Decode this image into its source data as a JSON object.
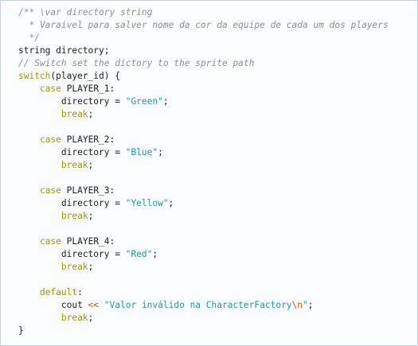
{
  "colors": {
    "background": "#fbfcfd",
    "border": "#c4cfe5",
    "comment": "#8f8f8f",
    "keyword": "#979a00",
    "string": "#1a9aa8",
    "escape": "#d14f00",
    "plain": "#202020"
  },
  "code_lines": [
    [
      {
        "type": "comment",
        "text": "/** \\var directory string"
      }
    ],
    [
      {
        "type": "comment",
        "text": "  * Varaivel para salver nome da cor da equipe de cada um dos players"
      }
    ],
    [
      {
        "type": "comment",
        "text": "  */"
      }
    ],
    [
      {
        "type": "plain",
        "text": "string directory;"
      }
    ],
    [
      {
        "type": "comment",
        "text": "// Switch set the dictory to the sprite path"
      }
    ],
    [
      {
        "type": "keyword",
        "text": "switch"
      },
      {
        "type": "plain",
        "text": "(player_id) {"
      }
    ],
    [
      {
        "type": "plain",
        "text": "    "
      },
      {
        "type": "keyword",
        "text": "case"
      },
      {
        "type": "plain",
        "text": " PLAYER_1:"
      }
    ],
    [
      {
        "type": "plain",
        "text": "        directory = "
      },
      {
        "type": "string",
        "text": "\"Green\""
      },
      {
        "type": "plain",
        "text": ";"
      }
    ],
    [
      {
        "type": "plain",
        "text": "        "
      },
      {
        "type": "keyword",
        "text": "break"
      },
      {
        "type": "plain",
        "text": ";"
      }
    ],
    [
      {
        "type": "plain",
        "text": ""
      }
    ],
    [
      {
        "type": "plain",
        "text": "    "
      },
      {
        "type": "keyword",
        "text": "case"
      },
      {
        "type": "plain",
        "text": " PLAYER_2:"
      }
    ],
    [
      {
        "type": "plain",
        "text": "        directory = "
      },
      {
        "type": "string",
        "text": "\"Blue\""
      },
      {
        "type": "plain",
        "text": ";"
      }
    ],
    [
      {
        "type": "plain",
        "text": "        "
      },
      {
        "type": "keyword",
        "text": "break"
      },
      {
        "type": "plain",
        "text": ";"
      }
    ],
    [
      {
        "type": "plain",
        "text": ""
      }
    ],
    [
      {
        "type": "plain",
        "text": "    "
      },
      {
        "type": "keyword",
        "text": "case"
      },
      {
        "type": "plain",
        "text": " PLAYER_3:"
      }
    ],
    [
      {
        "type": "plain",
        "text": "        directory = "
      },
      {
        "type": "string",
        "text": "\"Yellow\""
      },
      {
        "type": "plain",
        "text": ";"
      }
    ],
    [
      {
        "type": "plain",
        "text": "        "
      },
      {
        "type": "keyword",
        "text": "break"
      },
      {
        "type": "plain",
        "text": ";"
      }
    ],
    [
      {
        "type": "plain",
        "text": ""
      }
    ],
    [
      {
        "type": "plain",
        "text": "    "
      },
      {
        "type": "keyword",
        "text": "case"
      },
      {
        "type": "plain",
        "text": " PLAYER_4:"
      }
    ],
    [
      {
        "type": "plain",
        "text": "        directory = "
      },
      {
        "type": "string",
        "text": "\"Red\""
      },
      {
        "type": "plain",
        "text": ";"
      }
    ],
    [
      {
        "type": "plain",
        "text": "        "
      },
      {
        "type": "keyword",
        "text": "break"
      },
      {
        "type": "plain",
        "text": ";"
      }
    ],
    [
      {
        "type": "plain",
        "text": ""
      }
    ],
    [
      {
        "type": "plain",
        "text": "    "
      },
      {
        "type": "keyword",
        "text": "default"
      },
      {
        "type": "plain",
        "text": ":"
      }
    ],
    [
      {
        "type": "plain",
        "text": "        cout "
      },
      {
        "type": "operator",
        "text": "<<"
      },
      {
        "type": "plain",
        "text": " "
      },
      {
        "type": "string",
        "text": "\"Valor inválido na CharacterFactory"
      },
      {
        "type": "escape",
        "text": "\\n"
      },
      {
        "type": "string",
        "text": "\""
      },
      {
        "type": "plain",
        "text": ";"
      }
    ],
    [
      {
        "type": "plain",
        "text": "        "
      },
      {
        "type": "keyword",
        "text": "break"
      },
      {
        "type": "plain",
        "text": ";"
      }
    ],
    [
      {
        "type": "plain",
        "text": "}"
      }
    ]
  ]
}
